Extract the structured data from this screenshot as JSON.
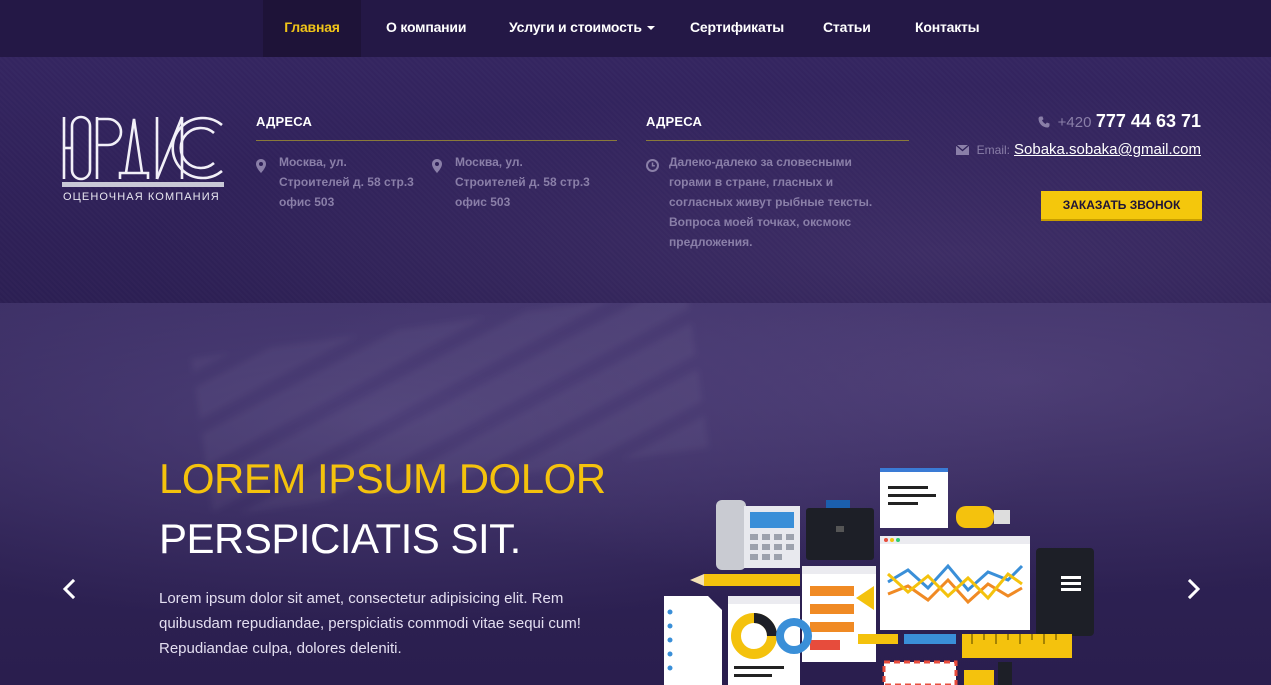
{
  "nav": {
    "items": [
      {
        "label": "Главная"
      },
      {
        "label": "О компании"
      },
      {
        "label": "Услуги и стоимость"
      },
      {
        "label": "Сертификаты"
      },
      {
        "label": "Статьи"
      },
      {
        "label": "Контакты"
      }
    ],
    "active_index": 0,
    "dropdown_index": 2
  },
  "logo": {
    "subtitle": "ОЦЕНОЧНАЯ КОМПАНИЯ"
  },
  "addresses": {
    "title": "АДРЕСА",
    "items": [
      {
        "line1": "Москва, ул.",
        "line2": "Строителей д. 58 стр.3",
        "line3": "офис 503",
        "icon": "map-pin-icon"
      },
      {
        "line1": "Москва, ул.",
        "line2": "Строителей д. 58 стр.3",
        "line3": "офис 503",
        "icon": "map-pin-icon"
      }
    ]
  },
  "hours": {
    "title": "АДРЕСА",
    "icon": "clock-icon",
    "lines": [
      "Далеко-далеко за словесными",
      "горами в стране, гласных и",
      "согласных живут рыбные тексты.",
      "Вопроса моей точках, оксмокс",
      "предложения."
    ]
  },
  "contact": {
    "phone_prefix": "+420",
    "phone_number": "777 44 63 71",
    "email_label": "Email:",
    "email": "Sobaka.sobaka@gmail.com",
    "callback_button": "ЗАКАЗАТЬ ЗВОНОК"
  },
  "hero": {
    "title_line1": "LOREM IPSUM DOLOR",
    "title_line2": "PERSPICIATIS SIT.",
    "text": "Lorem ipsum dolor sit amet, consectetur adipisicing elit. Rem quibusdam repudiandae, perspiciatis commodi vitae sequi cum! Repudiandae culpa, dolores deleniti.",
    "prev_icon": "chevron-left-icon",
    "next_icon": "chevron-right-icon"
  },
  "colors": {
    "accent": "#f4c20d",
    "nav_bg": "#241846",
    "header_bg": "#2f2158",
    "muted_text": "#8a7fa8"
  }
}
